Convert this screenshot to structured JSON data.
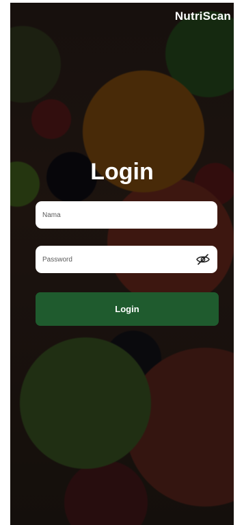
{
  "app": {
    "brand_name": "NutriScan"
  },
  "login": {
    "title": "Login",
    "name_placeholder": "Nama",
    "password_placeholder": "Password",
    "password_toggle_icon": "eye-off-icon",
    "submit_label": "Login"
  },
  "colors": {
    "button": "#1f5b2e",
    "field_background": "#ffffff",
    "text_light": "#ffffff"
  }
}
